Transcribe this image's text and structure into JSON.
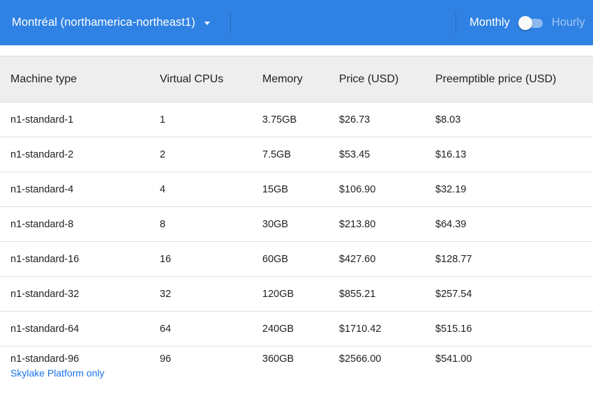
{
  "toolbar": {
    "region_label": "Montréal (northamerica-northeast1)",
    "toggle_on_label": "Monthly",
    "toggle_off_label": "Hourly",
    "toggle_state": "Monthly",
    "background_color": "#2f82e4"
  },
  "table": {
    "headers": [
      "Machine type",
      "Virtual CPUs",
      "Memory",
      "Price (USD)",
      "Preemptible price (USD)"
    ],
    "rows": [
      {
        "machine": "n1-standard-1",
        "cpus": "1",
        "memory": "3.75GB",
        "price": "$26.73",
        "preemptible": "$8.03"
      },
      {
        "machine": "n1-standard-2",
        "cpus": "2",
        "memory": "7.5GB",
        "price": "$53.45",
        "preemptible": "$16.13"
      },
      {
        "machine": "n1-standard-4",
        "cpus": "4",
        "memory": "15GB",
        "price": "$106.90",
        "preemptible": "$32.19"
      },
      {
        "machine": "n1-standard-8",
        "cpus": "8",
        "memory": "30GB",
        "price": "$213.80",
        "preemptible": "$64.39"
      },
      {
        "machine": "n1-standard-16",
        "cpus": "16",
        "memory": "60GB",
        "price": "$427.60",
        "preemptible": "$128.77"
      },
      {
        "machine": "n1-standard-32",
        "cpus": "32",
        "memory": "120GB",
        "price": "$855.21",
        "preemptible": "$257.54"
      },
      {
        "machine": "n1-standard-64",
        "cpus": "64",
        "memory": "240GB",
        "price": "$1710.42",
        "preemptible": "$515.16"
      },
      {
        "machine": "n1-standard-96",
        "cpus": "96",
        "memory": "360GB",
        "price": "$2566.00",
        "preemptible": "$541.00",
        "note": "Skylake Platform only"
      }
    ]
  }
}
